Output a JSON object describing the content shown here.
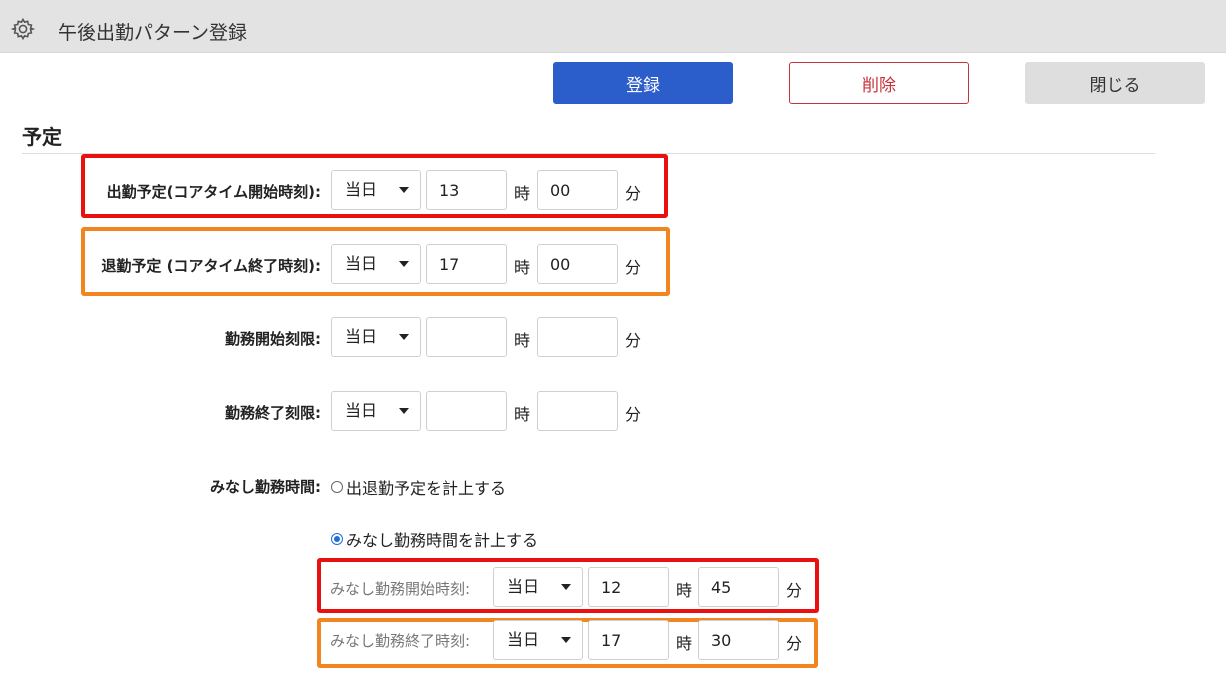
{
  "window": {
    "title": "午後出勤パターン登録",
    "icon": "gear-icon"
  },
  "toolbar": {
    "register_label": "登録",
    "delete_label": "削除",
    "close_label": "閉じる"
  },
  "section": {
    "title": "予定"
  },
  "rows": {
    "start_plan": {
      "label": "出勤予定(コアタイム開始時刻):",
      "day": "当日",
      "hour": "13",
      "minute": "00"
    },
    "end_plan": {
      "label": "退勤予定 (コアタイム終了時刻):",
      "day": "当日",
      "hour": "17",
      "minute": "00"
    },
    "work_start_limit": {
      "label": "勤務開始刻限:",
      "day": "当日",
      "hour": "",
      "minute": ""
    },
    "work_end_limit": {
      "label": "勤務終了刻限:",
      "day": "当日",
      "hour": "",
      "minute": ""
    },
    "deemed": {
      "label": "みなし勤務時間:",
      "option1": "出退勤予定を計上する",
      "option2": "みなし勤務時間を計上する",
      "selected": "option2"
    },
    "deemed_start": {
      "label": "みなし勤務開始時刻:",
      "day": "当日",
      "hour": "12",
      "minute": "45"
    },
    "deemed_end": {
      "label": "みなし勤務終了時刻:",
      "day": "当日",
      "hour": "17",
      "minute": "30"
    }
  },
  "units": {
    "hour": "時",
    "minute": "分"
  },
  "colors": {
    "primary": "#2b5ecb",
    "danger": "#c8323c",
    "highlight_red": "#ea1010",
    "highlight_orange": "#f2851f"
  }
}
